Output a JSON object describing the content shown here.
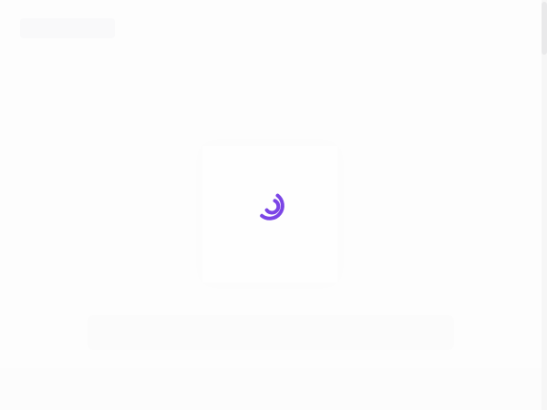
{
  "loader": {
    "icon": "loading-spinner-icon",
    "accent_color": "#7b45e6",
    "state": "loading"
  },
  "background_color": "#fdfdfd"
}
